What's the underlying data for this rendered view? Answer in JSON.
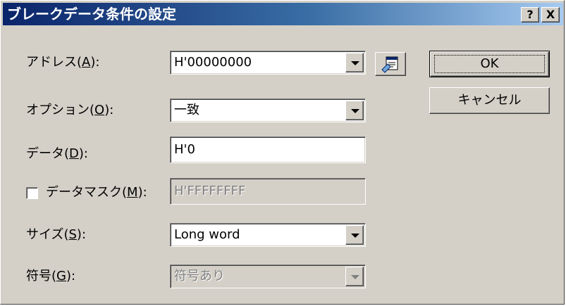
{
  "window": {
    "title": "ブレークデータ条件の設定",
    "help_button": "?",
    "close_button": "X"
  },
  "form": {
    "address": {
      "label_pre": "アドレス(",
      "mnemonic": "A",
      "label_post": "):",
      "value": "H'00000000"
    },
    "option": {
      "label_pre": "オプション(",
      "mnemonic": "O",
      "label_post": "):",
      "value": "一致"
    },
    "data": {
      "label_pre": "データ(",
      "mnemonic": "D",
      "label_post": "):",
      "value": "H'0"
    },
    "data_mask": {
      "label_pre": "データマスク(",
      "mnemonic": "M",
      "label_post": "):",
      "value": "H'FFFFFFFF",
      "checked": false
    },
    "size": {
      "label_pre": "サイズ(",
      "mnemonic": "S",
      "label_post": "):",
      "value": "Long word"
    },
    "sign": {
      "label_pre": "符号(",
      "mnemonic": "G",
      "label_post": "):",
      "value": "符号あり"
    }
  },
  "buttons": {
    "ok": "OK",
    "cancel": "キャンセル"
  },
  "icons": {
    "address_browse": "symbol-browse-icon",
    "dropdown": "chevron-down-icon",
    "help": "help-icon",
    "close": "close-icon"
  },
  "colors": {
    "title_start": "#0a246a",
    "title_end": "#a6caf0",
    "face": "#d4d0c8"
  }
}
